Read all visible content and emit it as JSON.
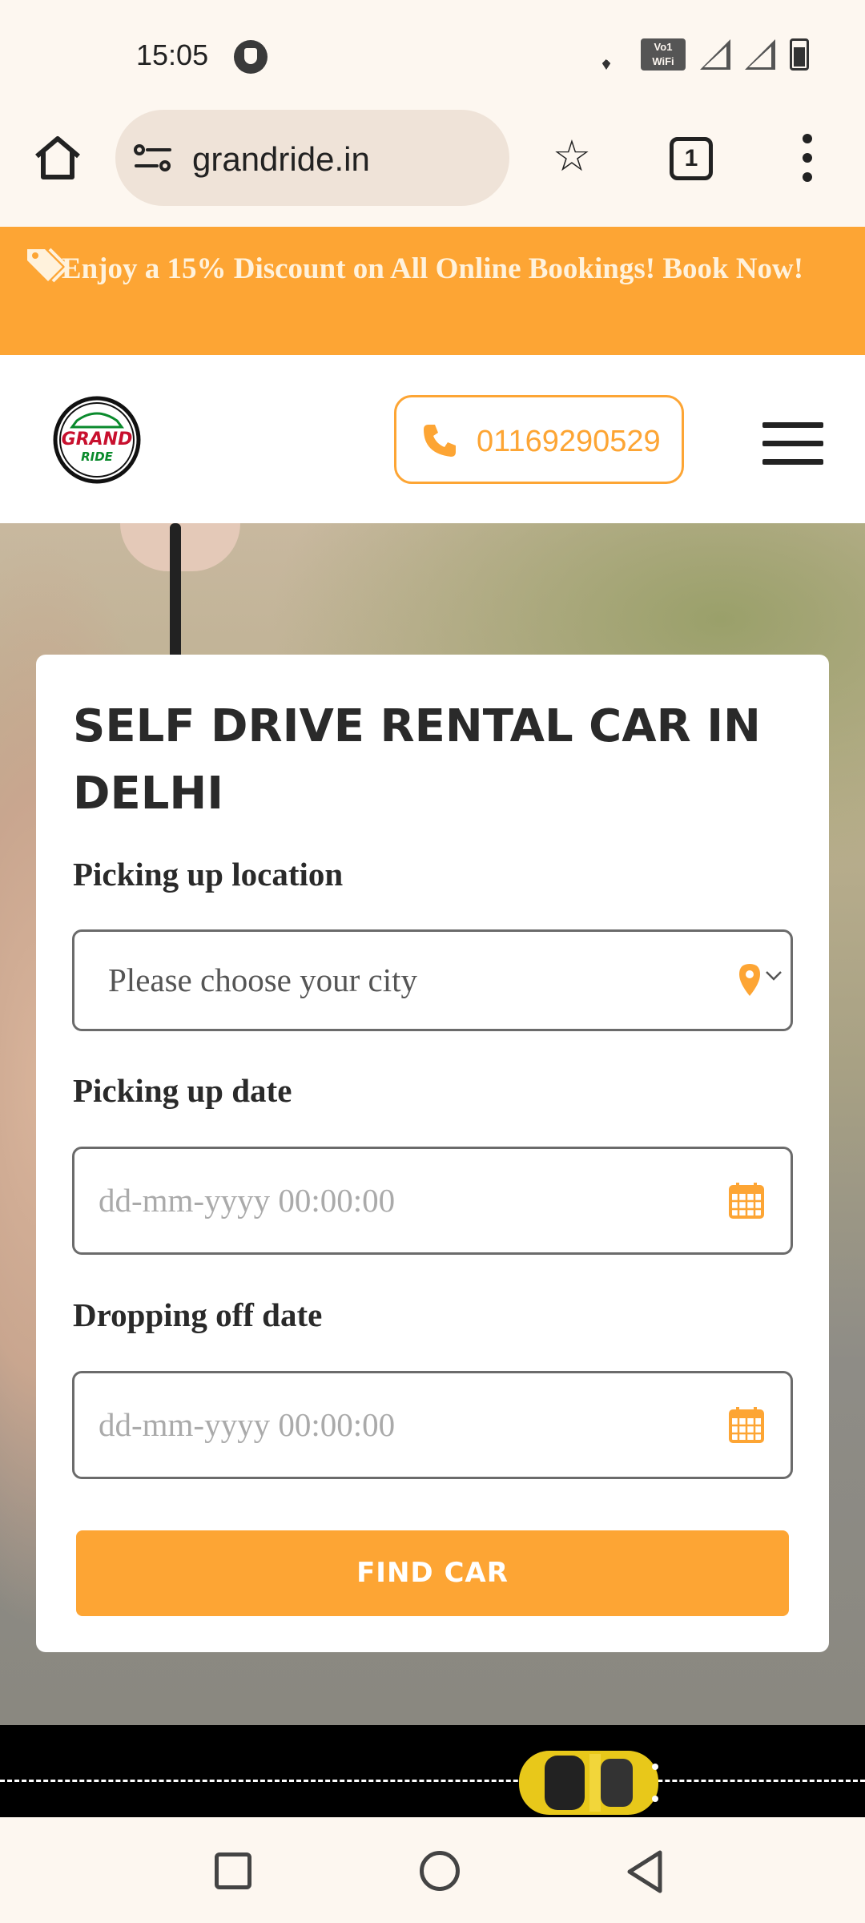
{
  "status_bar": {
    "time": "15:05",
    "vowifi_label_top": "Vo",
    "vowifi_label_bottom": "WiFi",
    "vowifi_sim": "1"
  },
  "browser": {
    "url": "grandride.in",
    "tab_count": "1",
    "icons": [
      "home-icon",
      "site-settings-icon",
      "star-icon",
      "tabs-icon",
      "more-vert-icon"
    ]
  },
  "promo": {
    "text": "Enjoy a 15% Discount on All Online Bookings! Book Now!",
    "icon": "tag-icon"
  },
  "header": {
    "logo_top": "GRAND",
    "logo_bottom": "RIDE",
    "phone": "01169290529",
    "colors": {
      "accent": "#fda534",
      "logo_red": "#c8102e",
      "logo_green": "#0a8a2c"
    }
  },
  "form": {
    "title": "SELF DRIVE RENTAL CAR IN DELHI",
    "pickup_location_label": "Picking up location",
    "pickup_location_value": "Please choose your city",
    "pickup_date_label": "Picking up date",
    "pickup_date_placeholder": "dd-mm-yyyy 00:00:00",
    "dropoff_date_label": "Dropping off date",
    "dropoff_date_placeholder": "dd-mm-yyyy 00:00:00",
    "submit_label": "FIND CAR"
  },
  "nav_bar": {
    "icons": [
      "recents-icon",
      "home-circle-icon",
      "back-icon"
    ]
  }
}
